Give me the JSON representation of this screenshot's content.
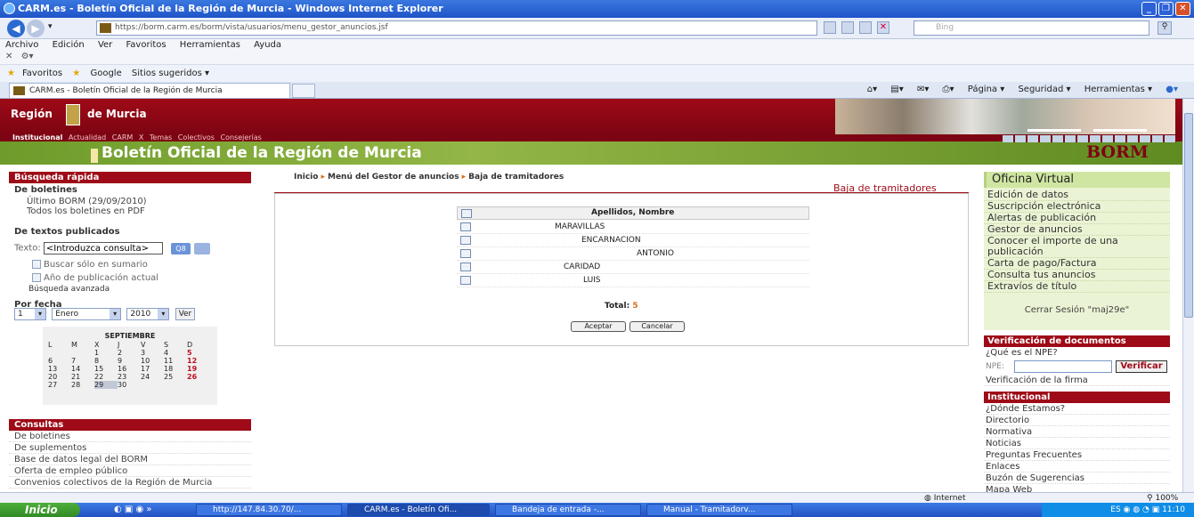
{
  "window": {
    "title": "CARM.es - Boletín Oficial de la Región de Murcia - Windows Internet Explorer"
  },
  "browser": {
    "url": "https://borm.carm.es/borm/vista/usuarios/menu_gestor_anuncios.jsf",
    "search_placeholder": "Bing",
    "menu": [
      "Archivo",
      "Edición",
      "Ver",
      "Favoritos",
      "Herramientas",
      "Ayuda"
    ],
    "favorites_label": "Favoritos",
    "fav_items": [
      "Google",
      "Sitios sugeridos ▾"
    ],
    "tab_title": "CARM.es - Boletín Oficial de la Región de Murcia",
    "commands": [
      "Página ▾",
      "Seguridad ▾",
      "Herramientas ▾"
    ]
  },
  "site": {
    "region_word": "Región",
    "murcia_word": "de Murcia",
    "nav": [
      "Institucional",
      "Actualidad",
      "CARM",
      "X",
      "Temas",
      "Colectivos",
      "Consejerías"
    ],
    "banner_title": "Boletín Oficial de la Región de Murcia",
    "logo": "BORM"
  },
  "left": {
    "quick_search": "Búsqueda rápida",
    "boletines_title": "De boletines",
    "ultimo": "Último BORM (29/09/2010)",
    "todos": "Todos los boletines en PDF",
    "textos_title": "De textos publicados",
    "texto_label": "Texto:",
    "texto_value": "<Introduzca consulta>",
    "go_label": "Q8",
    "solo_sumario": "Buscar sólo en sumario",
    "anio_actual": "Año de publicación actual",
    "avanzada": "Búsqueda avanzada",
    "por_fecha": "Por fecha",
    "day": "1",
    "month": "Enero",
    "year": "2010",
    "ver": "Ver",
    "calendar": {
      "month": "SEPTIEMBRE",
      "days": [
        "L",
        "M",
        "X",
        "J",
        "V",
        "S",
        "D"
      ],
      "weeks": [
        [
          "",
          "",
          "1",
          "2",
          "3",
          "4",
          "5"
        ],
        [
          "6",
          "7",
          "8",
          "9",
          "10",
          "11",
          "12"
        ],
        [
          "13",
          "14",
          "15",
          "16",
          "17",
          "18",
          "19"
        ],
        [
          "20",
          "21",
          "22",
          "23",
          "24",
          "25",
          "26"
        ],
        [
          "27",
          "28",
          "29",
          "30",
          "",
          "",
          ""
        ]
      ]
    },
    "consultas_title": "Consultas",
    "consultas": [
      "De boletines",
      "De suplementos",
      "Base de datos legal del BORM",
      "Oferta de empleo público",
      "Convenios colectivos de la Región de Murcia"
    ]
  },
  "main": {
    "breadcrumb": [
      "Inicio",
      "Menú del Gestor de anuncios",
      "Baja de tramitadores"
    ],
    "section_title": "Baja de tramitadores",
    "column_header": "Apellidos, Nombre",
    "rows": [
      "MARAVILLAS",
      "ENCARNACION",
      "ANTONIO",
      "CARIDAD",
      "LUIS"
    ],
    "total_label": "Total:",
    "total_value": "5",
    "accept": "Aceptar",
    "cancel": "Cancelar"
  },
  "right": {
    "ov_title": "Oficina Virtual",
    "ov_links": [
      "Edición de datos",
      "Suscripción electrónica",
      "Alertas de publicación",
      "Gestor de anuncios",
      "Conocer el importe de una publicación",
      "Carta de pago/Factura",
      "Consulta tus anuncios",
      "Extravíos de título"
    ],
    "cerrar": "Cerrar Sesión \"maj29e\"",
    "verif_title": "Verificación de documentos",
    "que_npe": "¿Qué es el NPE?",
    "npe_label": "NPE:",
    "verificar": "Verificar",
    "verif_firma": "Verificación de la firma",
    "inst_title": "Institucional",
    "inst_links": [
      "¿Dónde Estamos?",
      "Directorio",
      "Normativa",
      "Noticias",
      "Preguntas Frecuentes",
      "Enlaces",
      "Buzón de Sugerencias",
      "Mapa Web"
    ]
  },
  "status": {
    "zone": "Internet",
    "zoom": "100%"
  },
  "taskbar": {
    "start": "Inicio",
    "tasks": [
      "http://147.84.30.70/...",
      "CARM.es - Boletín Ofi...",
      "Bandeja de entrada -...",
      "Manual - Tramitadorv..."
    ],
    "lang": "ES",
    "clock": "11:10"
  }
}
